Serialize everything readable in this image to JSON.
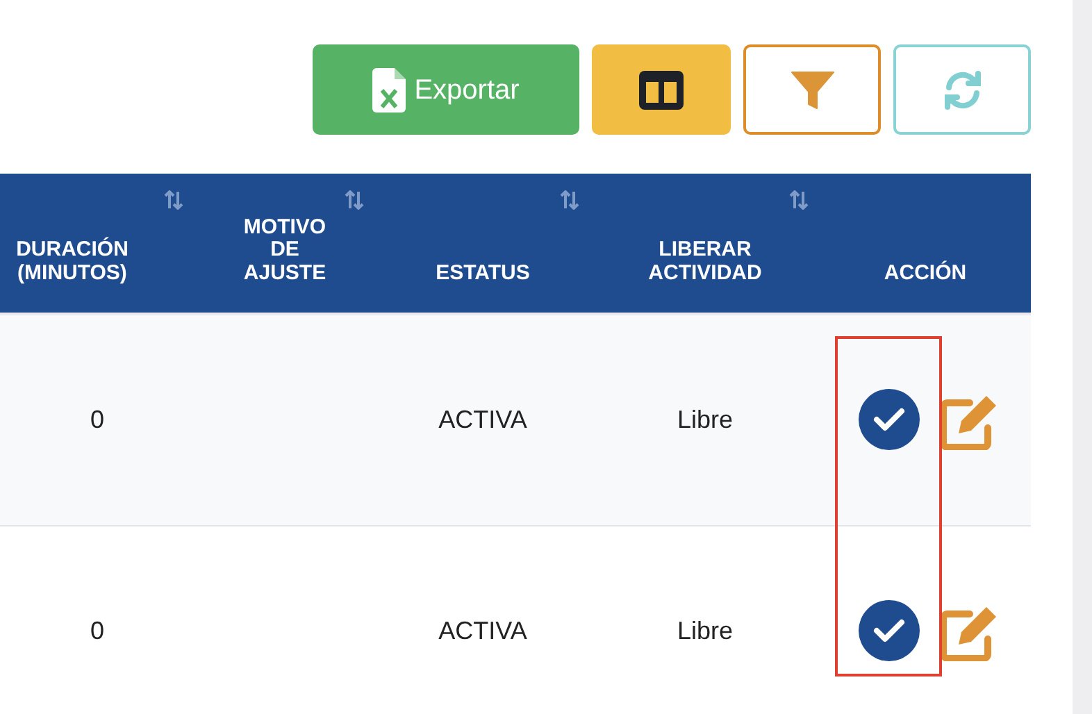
{
  "toolbar": {
    "export_label": "Exportar"
  },
  "table": {
    "columns": [
      {
        "label": "DURACIÓN (MINUTOS)",
        "sortable": true
      },
      {
        "label": "MOTIVO DE AJUSTE",
        "sortable": true
      },
      {
        "label": "ESTATUS",
        "sortable": true
      },
      {
        "label": "LIBERAR ACTIVIDAD",
        "sortable": true
      },
      {
        "label": "ACCIÓN",
        "sortable": false
      }
    ],
    "rows": [
      {
        "cells": [
          "0",
          "",
          "ACTIVA",
          "Libre"
        ],
        "confirmed": true
      },
      {
        "cells": [
          "0",
          "",
          "ACTIVA",
          "Libre"
        ],
        "confirmed": true
      }
    ]
  }
}
